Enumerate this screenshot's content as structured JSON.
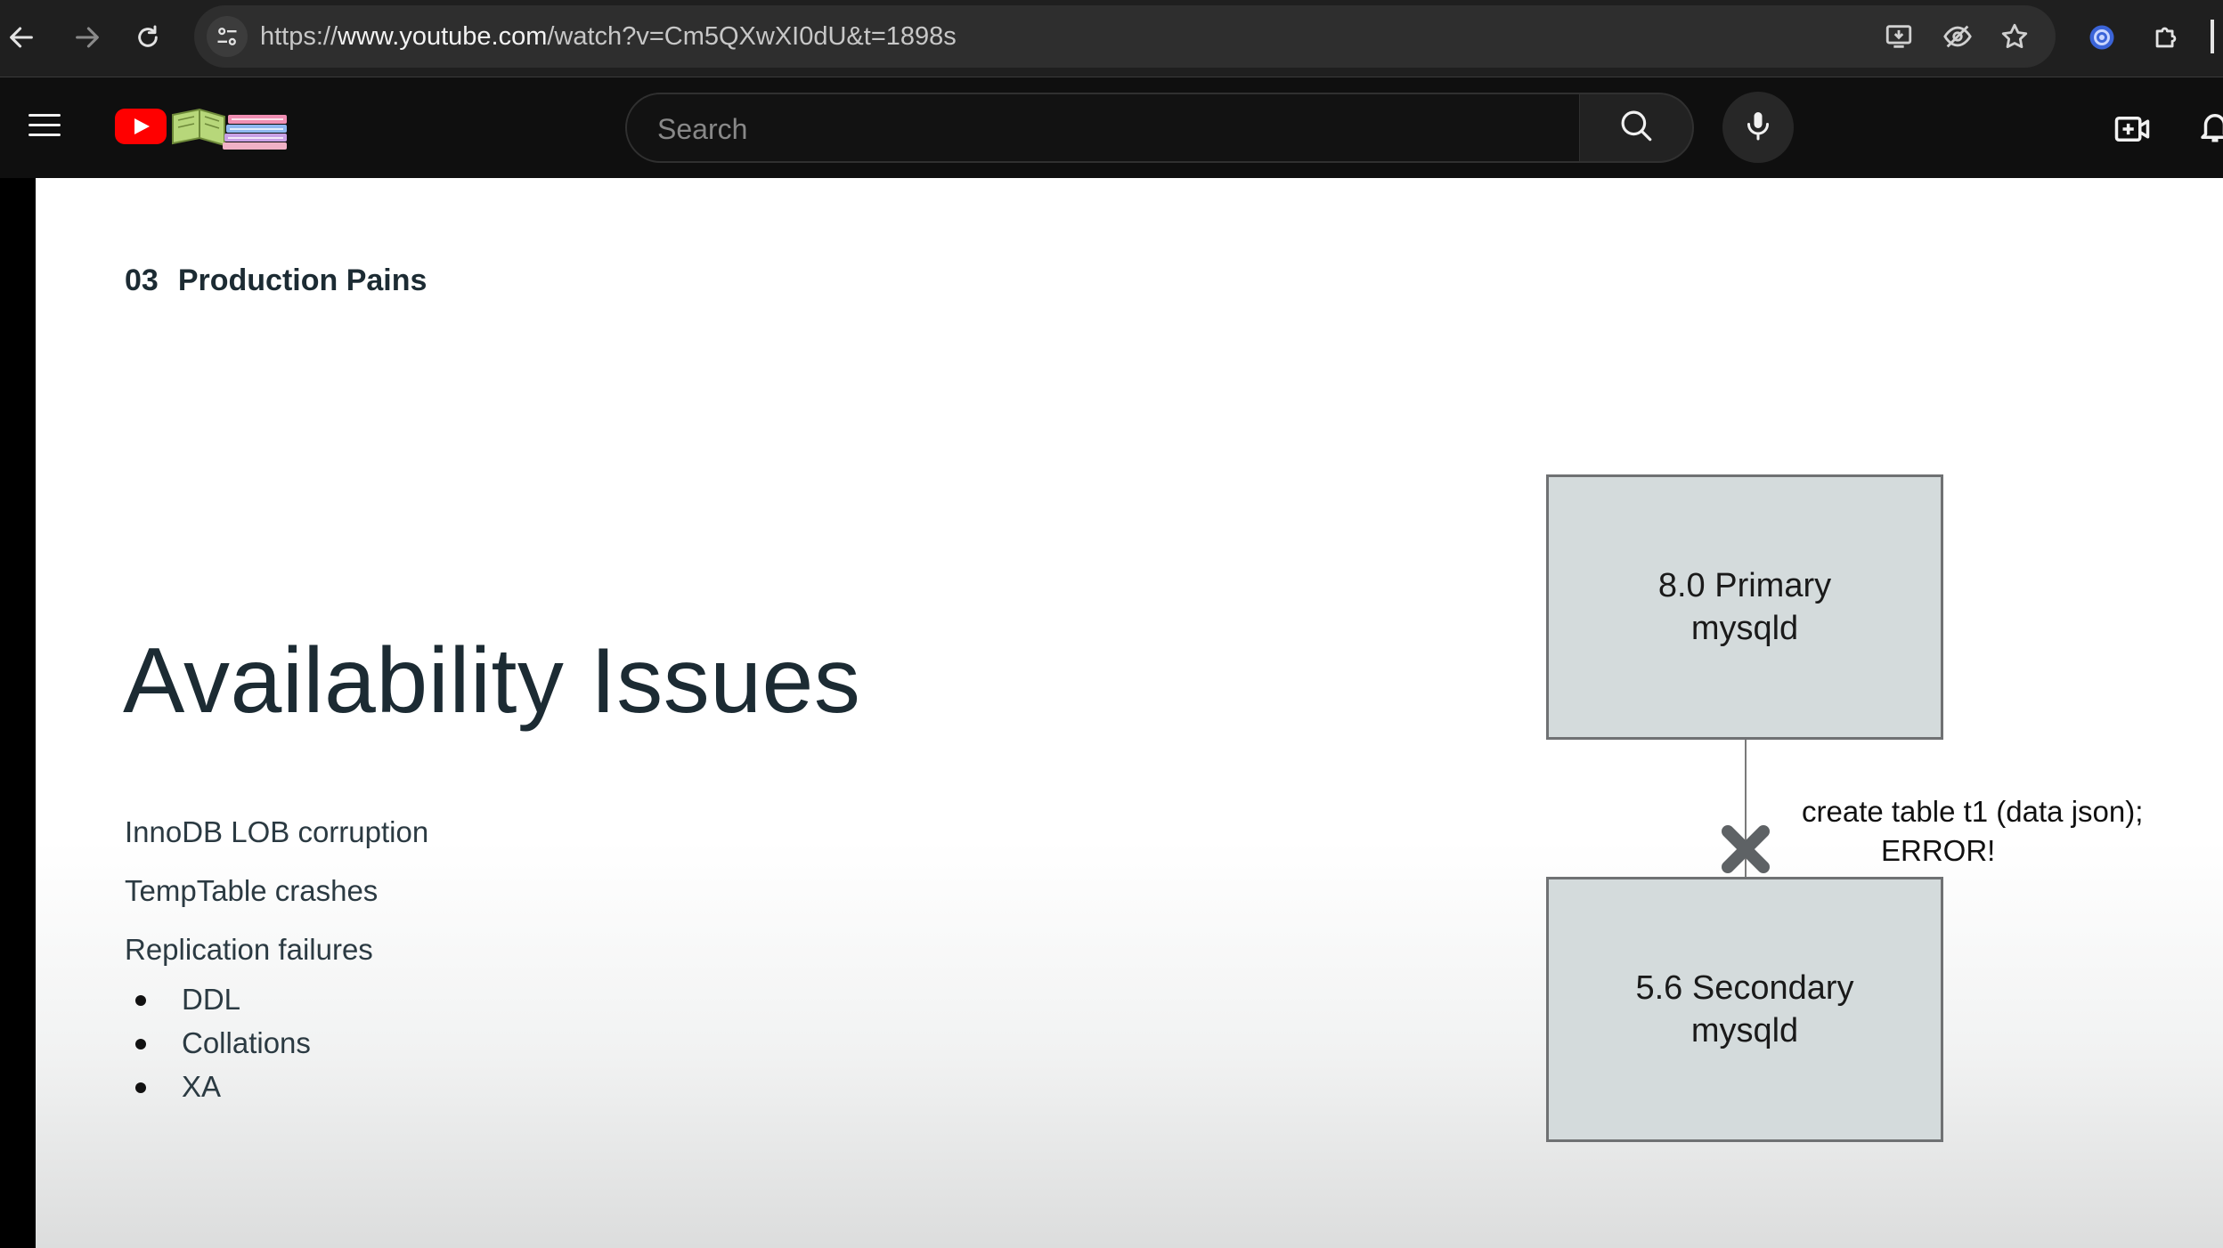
{
  "browser": {
    "url_scheme": "https://",
    "url_host": "www.youtube.com",
    "url_path": "/watch?v=Cm5QXwXI0dU&t=1898s"
  },
  "youtube": {
    "search_placeholder": "Search"
  },
  "slide": {
    "section_number": "03",
    "section_title": "Production Pains",
    "title": "Availability Issues",
    "items": [
      "InnoDB LOB corruption",
      "TempTable crashes",
      "Replication failures"
    ],
    "bullets": [
      "DDL",
      "Collations",
      "XA"
    ],
    "primary_box": {
      "line1": "8.0 Primary",
      "line2": "mysqld"
    },
    "secondary_box": {
      "line1": "5.6 Secondary",
      "line2": "mysqld"
    },
    "note": {
      "line1": "create table t1 (data json);",
      "line2": "ERROR!"
    }
  },
  "colors": {
    "youtube_red": "#ff0000",
    "box_fill": "#d4dbdc",
    "text_dark": "#1c2b33",
    "error_x": "#5e6265"
  },
  "icons": [
    "back-arrow-icon",
    "forward-arrow-icon",
    "reload-icon",
    "site-info-icon",
    "install-app-icon",
    "eye-slash-icon",
    "star-icon",
    "extension-profile-icon",
    "puzzle-icon",
    "hamburger-menu-icon",
    "youtube-logo-icon",
    "books-icon",
    "search-icon",
    "microphone-icon",
    "create-video-icon",
    "bell-icon",
    "error-x-icon"
  ]
}
